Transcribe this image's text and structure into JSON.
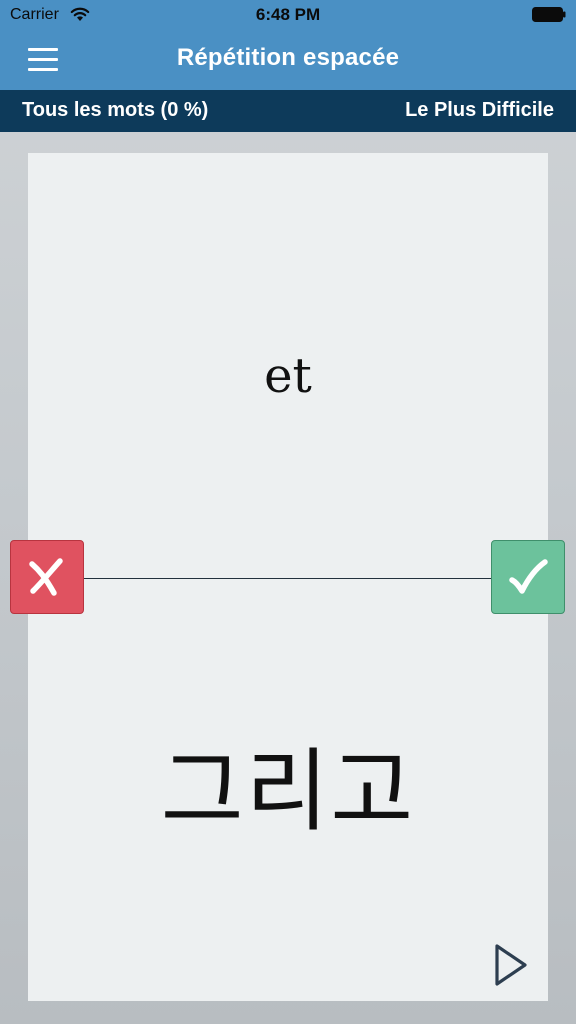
{
  "status_bar": {
    "carrier": "Carrier",
    "time": "6:48 PM"
  },
  "nav": {
    "title": "Répétition espacée"
  },
  "sub_bar": {
    "left_label": "Tous les mots (0 %)",
    "right_label": "Le Plus Difficile"
  },
  "card": {
    "front_text": "et",
    "back_text": "그리고"
  },
  "icons": {
    "menu": "hamburger-menu-icon",
    "wrong": "cross-icon",
    "right": "checkmark-icon",
    "play": "play-icon",
    "wifi": "wifi-icon",
    "battery": "battery-icon"
  },
  "colors": {
    "nav_background": "#4a90c4",
    "sub_bar_background": "#0d3a5a",
    "wrong_button": "#e05260",
    "right_button": "#6cc29c",
    "card_background": "#edf0f1"
  }
}
